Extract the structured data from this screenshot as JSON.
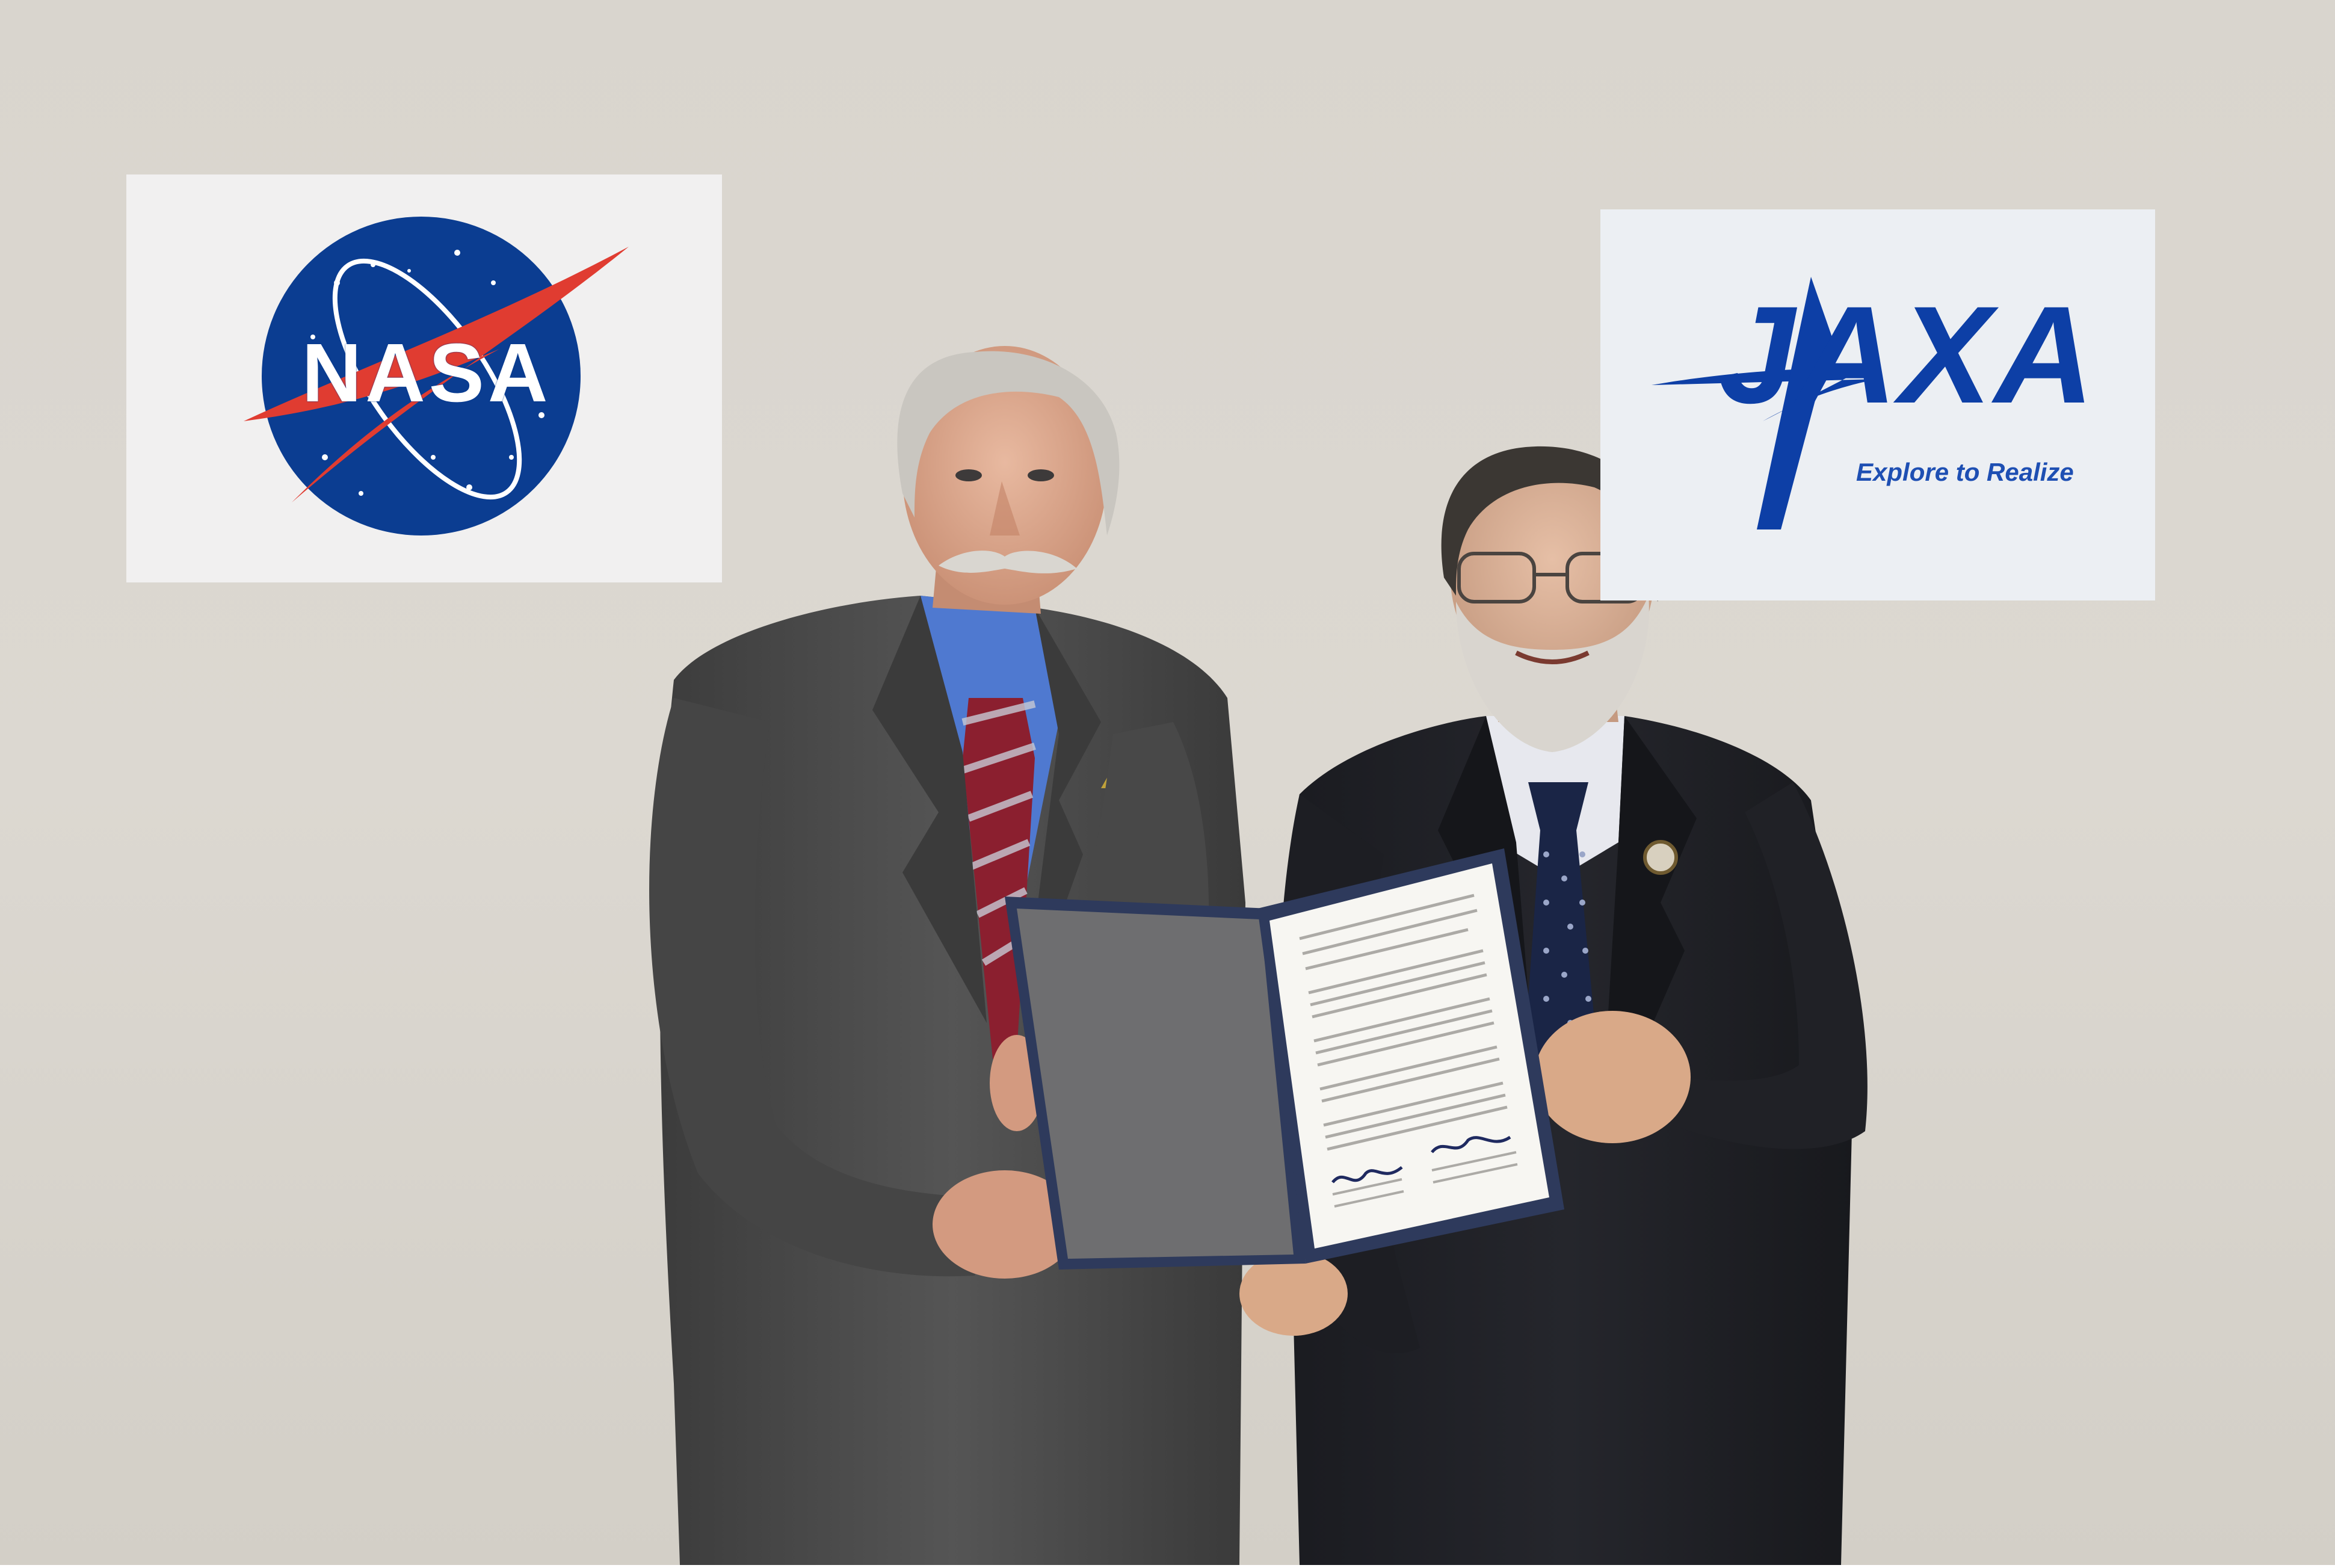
{
  "nasa_logo": {
    "text": "NASA",
    "colors": {
      "disc": "#0b3d91",
      "chevron": "#e03c31",
      "stars": "#ffffff"
    }
  },
  "jaxa_logo": {
    "text": "JAXA",
    "slogan": "Explore to Realize",
    "colors": {
      "wordmark": "#0d3fa6",
      "sign": "#eceff3"
    }
  },
  "colors": {
    "wall": "#dcd8d0",
    "left_suit": "#4b4b4b",
    "right_suit": "#1e1f24",
    "folder": "#2e3a5c"
  }
}
